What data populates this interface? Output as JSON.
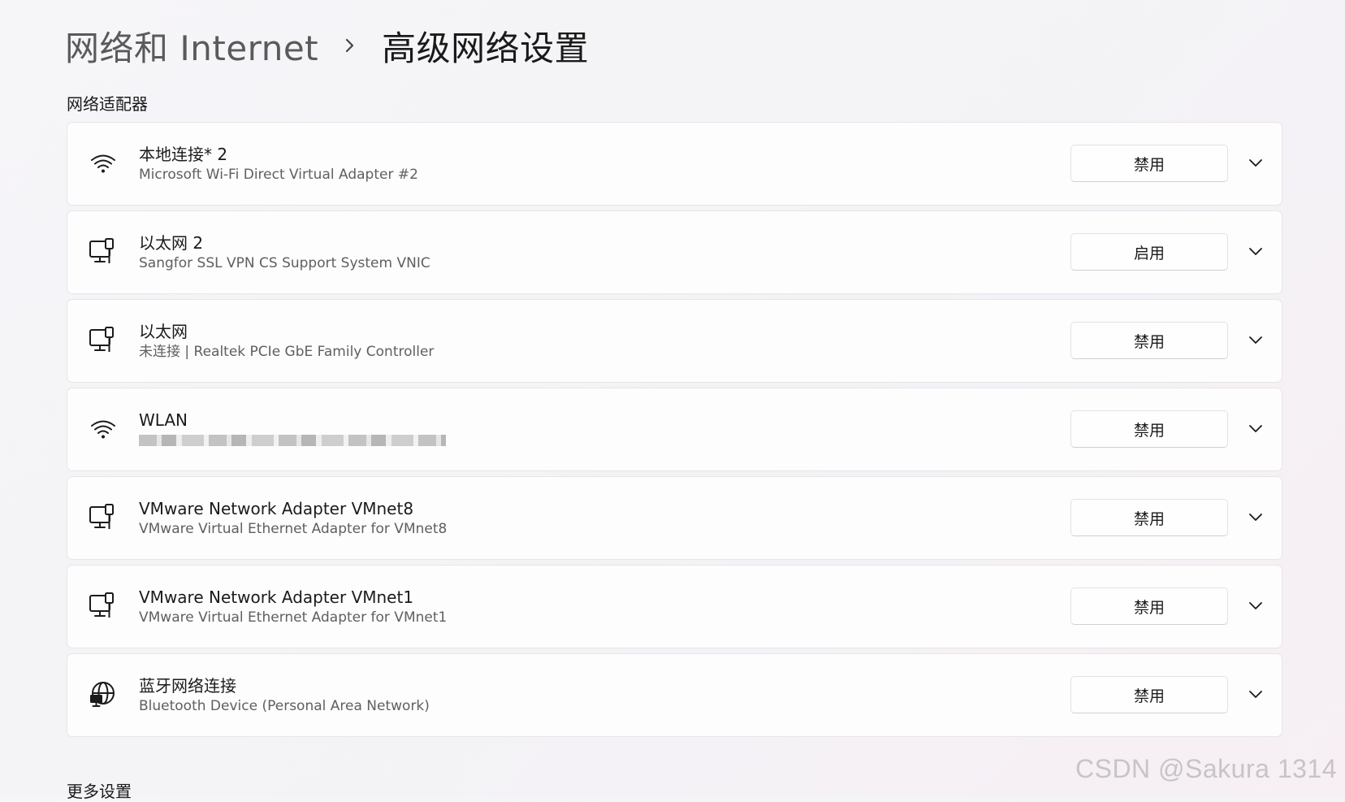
{
  "breadcrumb": {
    "parent": "网络和 Internet",
    "separator_icon": "chevron-right-icon",
    "current": "高级网络设置"
  },
  "sections": {
    "adapters_title": "网络适配器",
    "more_title": "更多设置"
  },
  "adapters": [
    {
      "name": "本地连接* 2",
      "desc": "Microsoft Wi-Fi Direct Virtual Adapter #2",
      "icon": "wifi-icon",
      "button": "禁用"
    },
    {
      "name": "以太网 2",
      "desc": "Sangfor SSL VPN CS Support System VNIC",
      "icon": "ethernet-icon",
      "button": "启用"
    },
    {
      "name": "以太网",
      "desc": "未连接 | Realtek PCIe GbE Family Controller",
      "icon": "ethernet-icon",
      "button": "禁用"
    },
    {
      "name": "WLAN",
      "desc": "",
      "icon": "wifi-icon",
      "button": "禁用"
    },
    {
      "name": "VMware Network Adapter VMnet8",
      "desc": "VMware Virtual Ethernet Adapter for VMnet8",
      "icon": "ethernet-icon",
      "button": "禁用"
    },
    {
      "name": "VMware Network Adapter VMnet1",
      "desc": "VMware Virtual Ethernet Adapter for VMnet1",
      "icon": "ethernet-icon",
      "button": "禁用"
    },
    {
      "name": "蓝牙网络连接",
      "desc": "Bluetooth Device (Personal Area Network)",
      "icon": "globe-network-icon",
      "button": "禁用"
    }
  ],
  "watermark": "CSDN @Sakura 1314"
}
